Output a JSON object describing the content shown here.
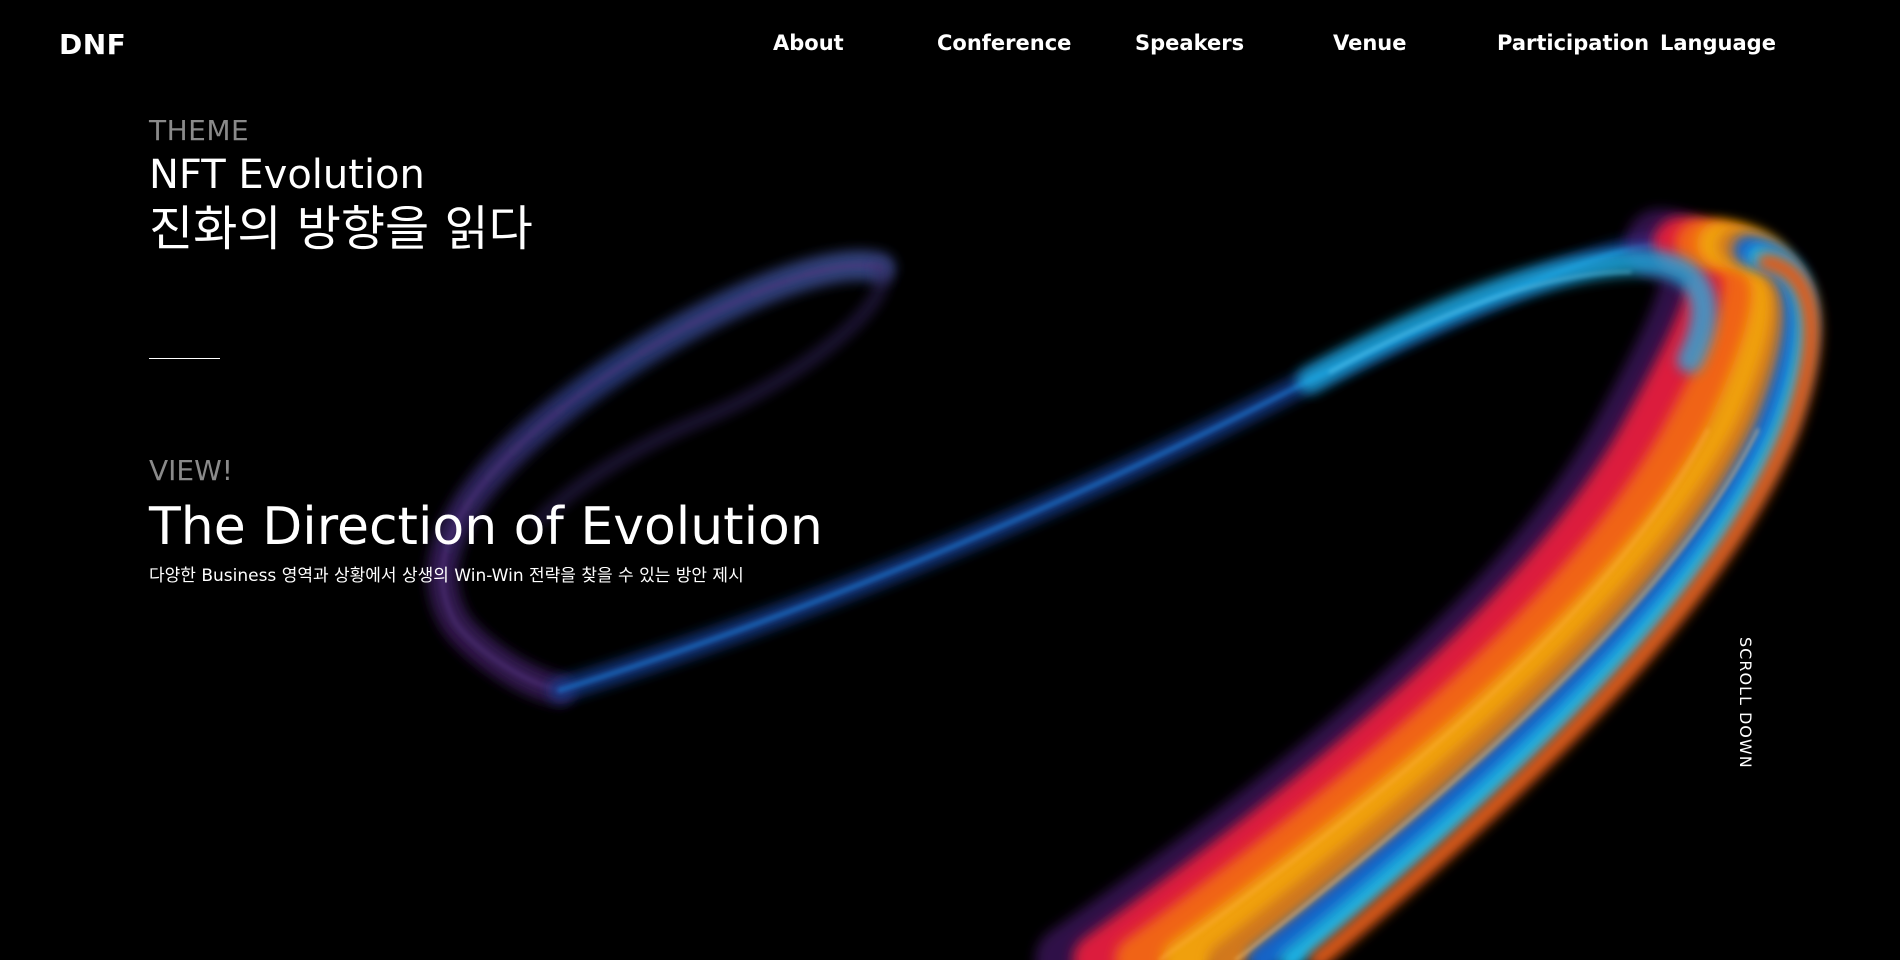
{
  "header": {
    "logo": "DNF",
    "nav": [
      {
        "label": "About"
      },
      {
        "label": "Conference"
      },
      {
        "label": "Speakers"
      },
      {
        "label": "Venue"
      },
      {
        "label": "Participation"
      },
      {
        "label": "Language"
      }
    ]
  },
  "hero": {
    "theme_label": "THEME",
    "theme_title": "NFT Evolution",
    "theme_korean": "진화의 방향을 읽다",
    "view_label": "VIEW!",
    "view_title": "The Direction of Evolution",
    "view_desc": "다양한 Business 영역과 상황에서 상생의 Win-Win 전략을 찾을 수 있는 방안 제시"
  },
  "scroll_label": "SCROLL DOWN",
  "colors": {
    "background": "#000000",
    "muted_text": "#8a8a8a",
    "ribbon": [
      "#1464c8",
      "#1ab4e6",
      "#7828a0",
      "#dc1e3c",
      "#f06414",
      "#f0a00a",
      "#501e78"
    ]
  }
}
